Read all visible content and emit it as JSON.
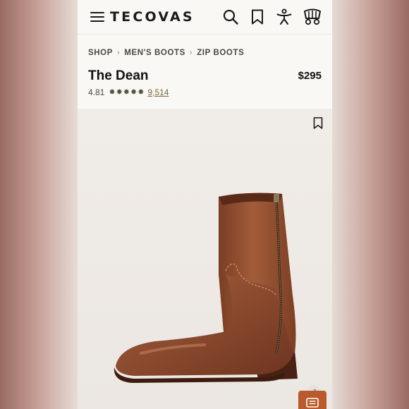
{
  "brand": {
    "logo_text": "TECOVAS"
  },
  "header": {
    "icons": [
      "menu-icon",
      "search-icon",
      "bookmark-icon",
      "account-icon",
      "cart-wagon-icon"
    ]
  },
  "breadcrumb": {
    "items": [
      {
        "label": "SHOP"
      },
      {
        "label": "MEN'S BOOTS"
      },
      {
        "label": "ZIP BOOTS"
      }
    ],
    "separator": "›"
  },
  "product": {
    "name": "The Dean",
    "price": "$295",
    "rating": "4.81",
    "stars": 5,
    "reviews_count": "9,514",
    "image_alt": "Brown leather zip boot"
  },
  "colors": {
    "accent_olive": "#4c5236",
    "link_gold": "#7a6a3a",
    "chat_orange": "#b95a2c",
    "leather_brown": "#8a4a2e"
  }
}
